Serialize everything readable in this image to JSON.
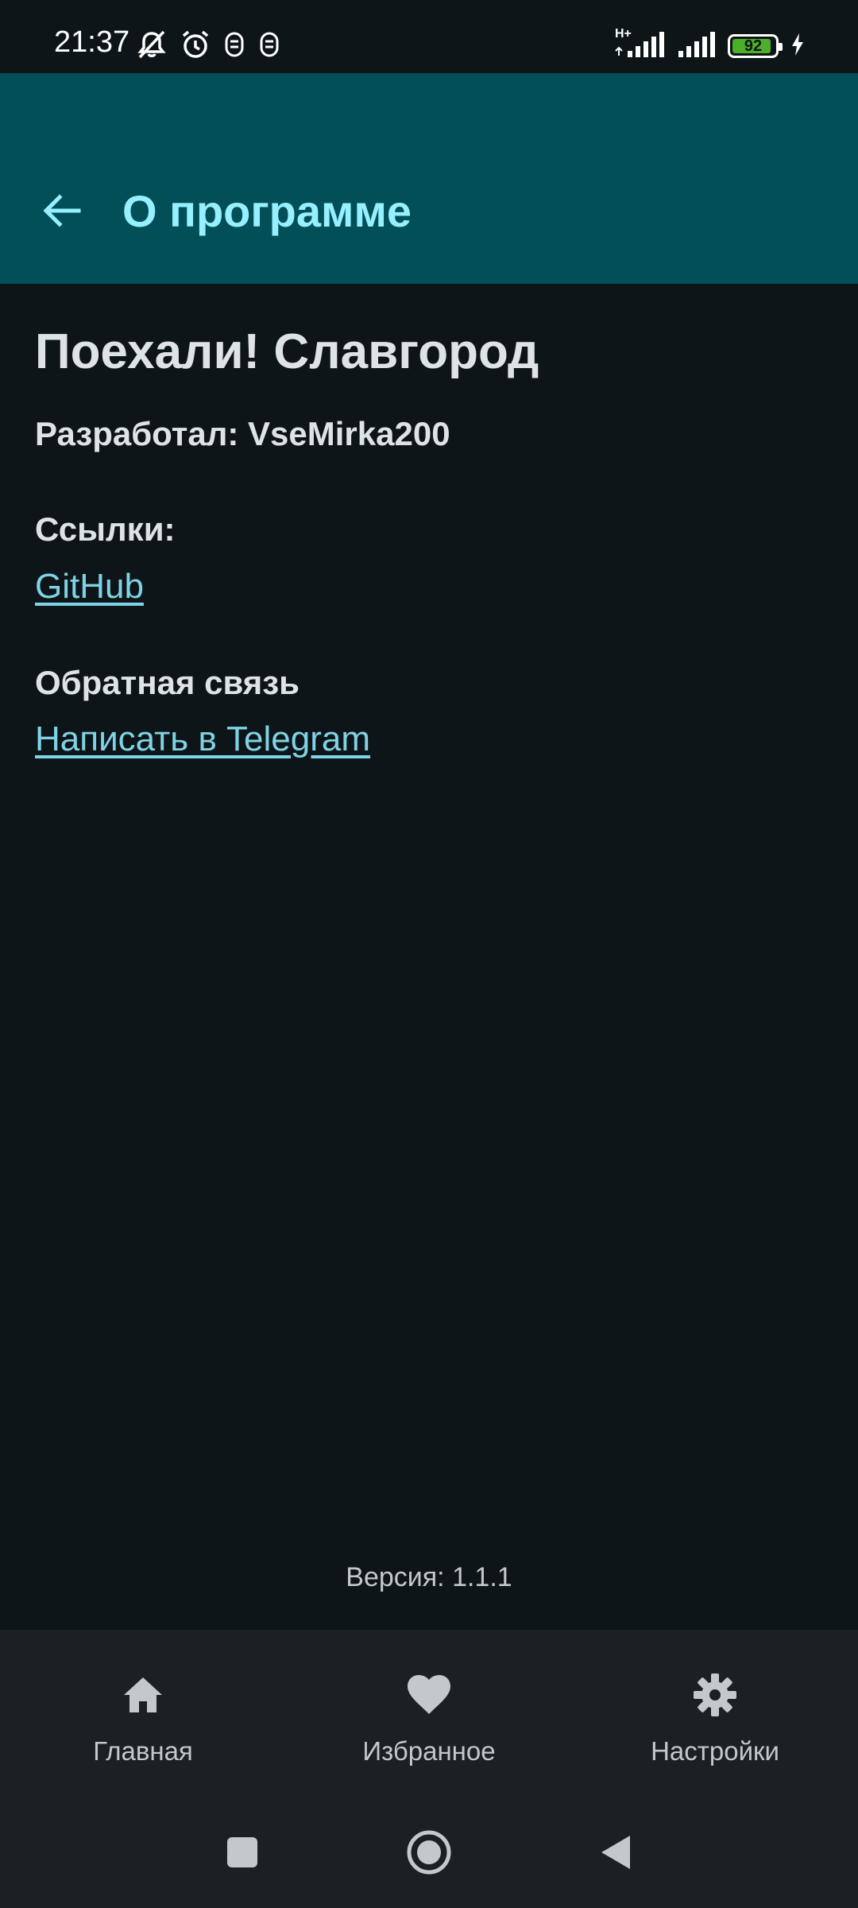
{
  "status_bar": {
    "time": "21:37",
    "battery_percent": "92",
    "battery_level": 0.92,
    "network_label": "H+",
    "icons_left": [
      "mute-icon",
      "alarm-icon",
      "notification-icon",
      "notification-icon"
    ],
    "icons_right": [
      "signal-icon",
      "signal-icon",
      "battery-icon",
      "charging-icon"
    ]
  },
  "app_bar": {
    "title": "О программе",
    "back_icon": "arrow-back-icon"
  },
  "about": {
    "app_name": "Поехали! Славгород",
    "developer": "Разработал: VseMirka200",
    "links_heading": "Ссылки:",
    "github_link": "GitHub",
    "feedback_heading": "Обратная связь",
    "telegram_link": "Написать в Telegram"
  },
  "version": "Версия: 1.1.1",
  "bottom_nav": {
    "items": [
      {
        "label": "Главная",
        "icon": "home-icon"
      },
      {
        "label": "Избранное",
        "icon": "heart-icon"
      },
      {
        "label": "Настройки",
        "icon": "gear-icon"
      }
    ]
  },
  "system_nav": [
    "recents-icon",
    "home-circle-icon",
    "back-triangle-icon"
  ],
  "colors": {
    "background": "#0e1518",
    "app_bar": "#024f58",
    "title_accent": "#97f0ff",
    "link": "#7fd3e6",
    "nav_bar": "#1a2024",
    "battery_fill": "#4caf2a"
  }
}
